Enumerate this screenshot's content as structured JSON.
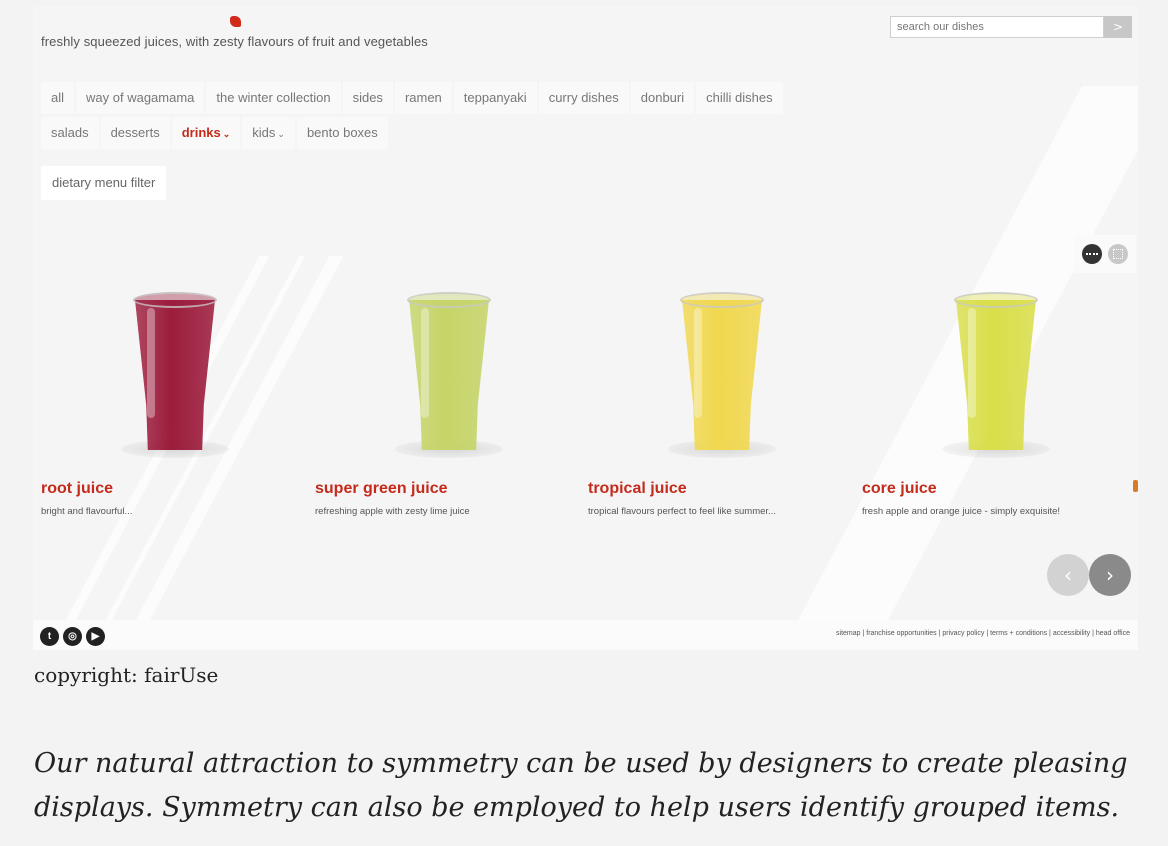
{
  "header": {
    "tagline": "freshly squeezed juices, with zesty flavours of fruit and vegetables",
    "logo_accent": "#d12a1a"
  },
  "search": {
    "placeholder": "search our dishes",
    "button_label": ">"
  },
  "nav": {
    "row1": [
      "all",
      "way of wagamama",
      "the winter collection",
      "sides",
      "ramen",
      "teppanyaki",
      "curry dishes",
      "donburi",
      "chilli dishes"
    ],
    "row2": [
      {
        "label": "salads",
        "dropdown": false,
        "active": false
      },
      {
        "label": "desserts",
        "dropdown": false,
        "active": false
      },
      {
        "label": "drinks",
        "dropdown": true,
        "active": true
      },
      {
        "label": "kids",
        "dropdown": true,
        "active": false
      },
      {
        "label": "bento boxes",
        "dropdown": false,
        "active": false
      }
    ],
    "dropdown_glyph": "⌄",
    "active_color": "#c42b1c"
  },
  "filter": {
    "label": "dietary menu filter"
  },
  "view_toggle": {
    "icons": [
      "list-view-icon",
      "grid-view-icon"
    ],
    "selected": "list-view-icon"
  },
  "products": [
    {
      "name": "root juice",
      "description": "bright and flavourful...",
      "color": "#9c1c3c"
    },
    {
      "name": "super green juice",
      "description": "refreshing apple with zesty lime juice",
      "color": "#c6d468"
    },
    {
      "name": "tropical juice",
      "description": "tropical flavours perfect to feel like summer...",
      "color": "#f1d850"
    },
    {
      "name": "core juice",
      "description": "fresh apple and orange juice - simply exquisite!",
      "color": "#d9de4a"
    }
  ],
  "carousel": {
    "prev_label": "‹",
    "next_label": "›"
  },
  "footer": {
    "social_icons": [
      "twitter-icon",
      "instagram-icon",
      "youtube-icon"
    ],
    "links": "sitemap | franchise opportunities | privacy policy | terms + conditions | accessibility | head office"
  },
  "page": {
    "copyright": "copyright: fairUse",
    "caption": "Our natural attraction to symmetry can be used by designers to create pleasing displays. Symmetry can also be employed to help users identify grouped items."
  }
}
